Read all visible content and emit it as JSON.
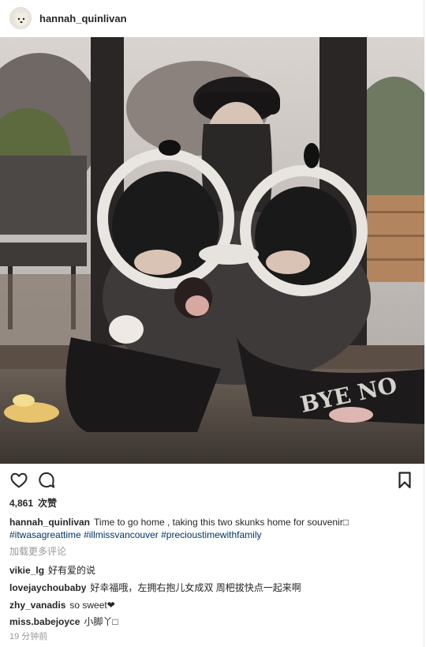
{
  "post": {
    "username": "hannah_quinlivan",
    "likes_count": "4,861",
    "likes_suffix": "次赞",
    "caption": {
      "username": "hannah_quinlivan",
      "text": "Time to go home , taking this two skunks home for souvenir□",
      "hashtags": [
        "#itwasagreattime",
        "#illmissvancouver",
        "#precioustimewithfamily"
      ]
    },
    "load_more": "加载更多评论",
    "comments": [
      {
        "username": "vikie_lg",
        "text": "好有爱的说"
      },
      {
        "username": "lovejaychoubaby",
        "text": "好幸福哦，左拥右抱儿女成双   周杷拔快点一起来啊"
      },
      {
        "username": "zhy_vanadis",
        "text": "so sweet❤"
      },
      {
        "username": "miss.babejoyce",
        "text": "小脚丫□"
      }
    ],
    "timestamp": "19 分钟前",
    "photo_text": "BYE NO"
  },
  "icons": {
    "like": "heart-icon",
    "comment": "comment-bubble-icon",
    "save": "bookmark-icon"
  }
}
